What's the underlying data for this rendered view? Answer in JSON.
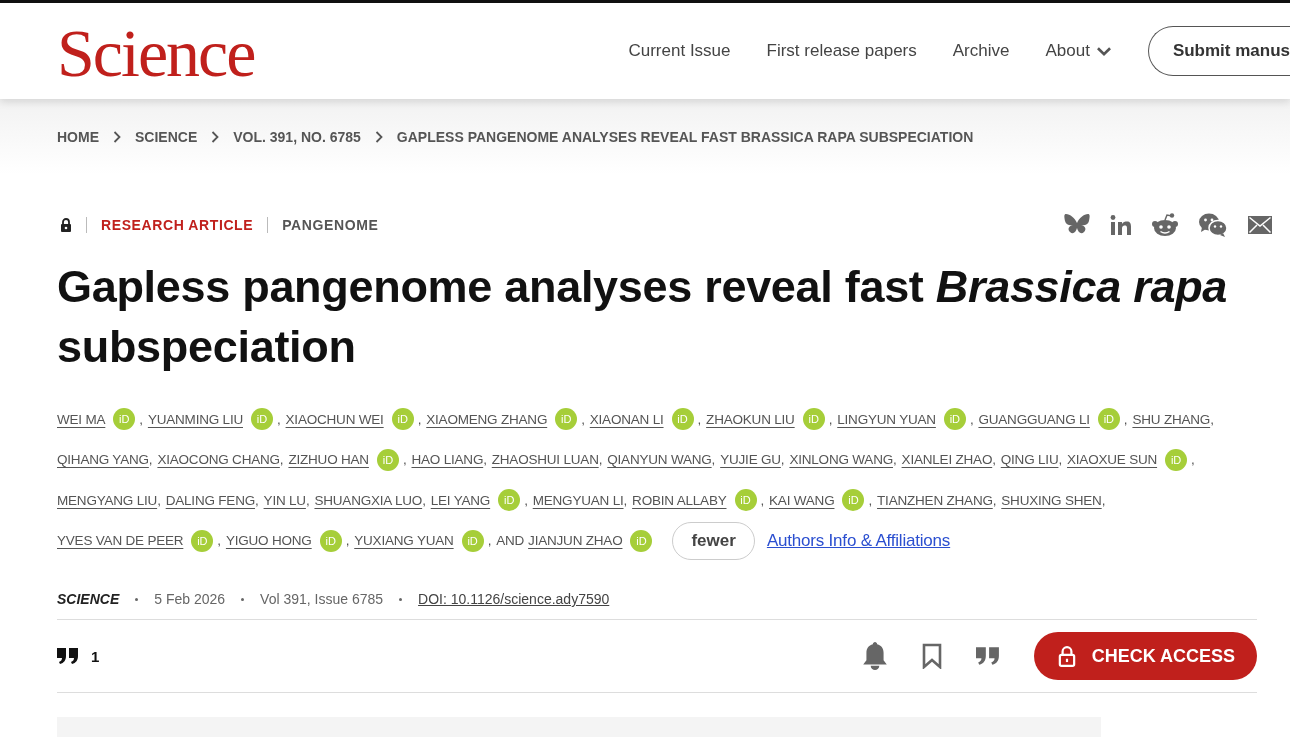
{
  "header": {
    "logo": "Science",
    "nav": [
      {
        "label": "Current Issue",
        "dropdown": false
      },
      {
        "label": "First release papers",
        "dropdown": false
      },
      {
        "label": "Archive",
        "dropdown": false
      },
      {
        "label": "About",
        "dropdown": true
      }
    ],
    "submit_button": "Submit manus"
  },
  "breadcrumb": [
    "HOME",
    "SCIENCE",
    "VOL. 391, NO. 6785",
    "GAPLESS PANGENOME ANALYSES REVEAL FAST BRASSICA RAPA SUBSPECIATION"
  ],
  "article": {
    "locked": true,
    "type": "RESEARCH ARTICLE",
    "topic": "PANGENOME",
    "title": "Gapless pangenome analyses reveal fast *Brassica rapa* subspeciation",
    "author_lines": [
      [
        {
          "name": "WEI MA",
          "orcid": "iD",
          "sep": ","
        },
        {
          "name": "YUANMING LIU",
          "orcid": "iD",
          "sep": ","
        },
        {
          "name": "XIAOCHUN WEI",
          "orcid": "iD",
          "sep": ","
        },
        {
          "name": "XIAOMENG ZHANG",
          "orcid": "iD",
          "sep": ","
        },
        {
          "name": "XIAONAN LI",
          "orcid": "iD",
          "sep": ","
        },
        {
          "name": "ZHAOKUN LIU",
          "orcid": "iD",
          "sep": ","
        },
        {
          "name": "LINGYUN YUAN",
          "orcid": "iD",
          "sep": ","
        },
        {
          "name": "GUANGGUANG LI",
          "orcid": "iD",
          "sep": ","
        },
        {
          "name": "SHU ZHANG",
          "sep": ","
        }
      ],
      [
        {
          "name": "QIHANG YANG",
          "sep": ","
        },
        {
          "name": "XIAOCONG CHANG",
          "sep": ","
        },
        {
          "name": "ZIZHUO HAN",
          "orcid": "iD",
          "sep": ","
        },
        {
          "name": "HAO LIANG",
          "sep": ","
        },
        {
          "name": "ZHAOSHUI LUAN",
          "sep": ","
        },
        {
          "name": "QIANYUN WANG",
          "sep": ","
        },
        {
          "name": "YUJIE GU",
          "sep": ","
        },
        {
          "name": "XINLONG WANG",
          "sep": ","
        },
        {
          "name": "XIANLEI ZHAO",
          "sep": ","
        },
        {
          "name": "QING LIU",
          "sep": ","
        },
        {
          "name": "XIAOXUE SUN",
          "orcid": "iD",
          "sep": ","
        }
      ],
      [
        {
          "name": "MENGYANG LIU",
          "sep": ","
        },
        {
          "name": "DALING FENG",
          "sep": ","
        },
        {
          "name": "YIN LU",
          "sep": ","
        },
        {
          "name": "SHUANGXIA LUO",
          "sep": ","
        },
        {
          "name": "LEI YANG",
          "orcid": "iD",
          "sep": ","
        },
        {
          "name": "MENGYUAN LI",
          "sep": ","
        },
        {
          "name": "ROBIN ALLABY",
          "orcid": "iD",
          "sep": ","
        },
        {
          "name": "KAI WANG",
          "orcid": "iD",
          "sep": ","
        },
        {
          "name": "TIANZHEN ZHANG",
          "sep": ","
        },
        {
          "name": "SHUXING SHEN",
          "sep": ","
        }
      ],
      [
        {
          "name": "YVES VAN DE PEER",
          "orcid": "iD",
          "sep": ","
        },
        {
          "name": "YIGUO HONG",
          "orcid": "iD",
          "sep": ","
        },
        {
          "name": "YUXIANG YUAN",
          "orcid": "iD",
          "sep": ","
        },
        {
          "prefix": "AND",
          "name": "JIANJUN ZHAO",
          "orcid": "iD"
        }
      ]
    ],
    "fewer_button": "fewer",
    "affiliations_link": "Authors Info & Affiliations",
    "journal": "SCIENCE",
    "date": "5 Feb 2026",
    "volume": "Vol 391, Issue 6785",
    "doi": "DOI: 10.1126/science.ady7590",
    "citations": "1",
    "check_access": "CHECK ACCESS"
  }
}
